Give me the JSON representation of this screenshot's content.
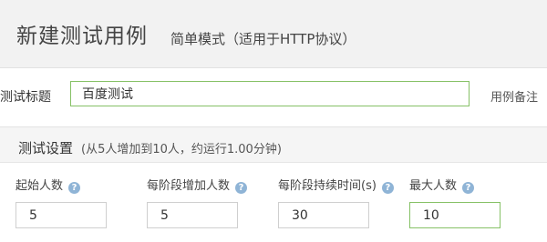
{
  "header": {
    "title": "新建测试用例",
    "mode": "简单模式（适用于HTTP协议）"
  },
  "form": {
    "title_label": "测试标题",
    "title_value": "百度测试",
    "notes_label": "用例备注"
  },
  "settings": {
    "title": "测试设置",
    "summary": "(从5人增加到10人，约运行1.00分钟)",
    "fields": [
      {
        "label": "起始人数",
        "value": "5"
      },
      {
        "label": "每阶段增加人数",
        "value": "5"
      },
      {
        "label": "每阶段持续时间(s)",
        "value": "30"
      },
      {
        "label": "最大人数",
        "value": "10"
      }
    ]
  },
  "icons": {
    "help": "question-circle-icon"
  },
  "colors": {
    "accent_border": "#86c166",
    "help_icon": "#8fb4d6",
    "header_bg": "#f2f2f2"
  }
}
